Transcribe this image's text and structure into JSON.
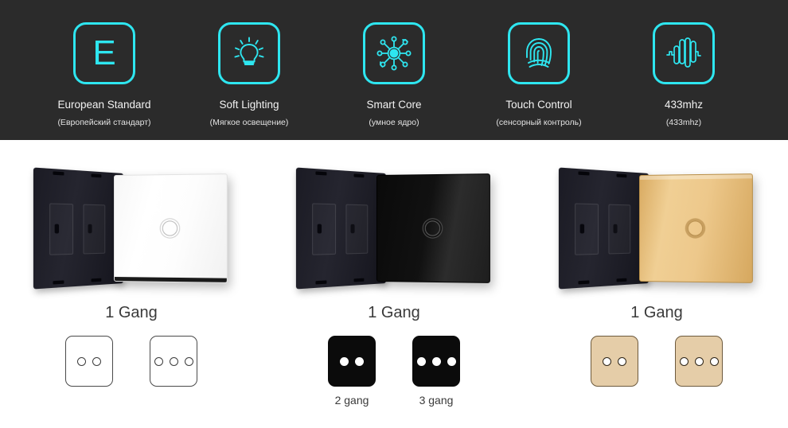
{
  "banner": {
    "background_color": "#2b2b2b",
    "accent_color": "#2ee6f0",
    "features": [
      {
        "icon": "letter-e-icon",
        "glyph": "E",
        "label": "European Standard",
        "sublabel": "(Европейский стандарт)"
      },
      {
        "icon": "lightbulb-icon",
        "glyph": "",
        "label": "Soft Lighting",
        "sublabel": "(Мягкое освещение)"
      },
      {
        "icon": "smart-core-hub-icon",
        "glyph": "",
        "label": "Smart Core",
        "sublabel": "(умное ядро)"
      },
      {
        "icon": "fingerprint-icon",
        "glyph": "",
        "label": "Touch Control",
        "sublabel": "(сенсорный контроль)"
      },
      {
        "icon": "radio-waveform-icon",
        "glyph": "",
        "label": "433mhz",
        "sublabel": "(433mhz)"
      }
    ]
  },
  "products": [
    {
      "color_name": "white",
      "panel_color": "#ffffff",
      "caption": "1 Gang",
      "variants": [
        {
          "gangs": 2,
          "label": ""
        },
        {
          "gangs": 3,
          "label": ""
        }
      ]
    },
    {
      "color_name": "black",
      "panel_color": "#0b0b0b",
      "caption": "1 Gang",
      "variants": [
        {
          "gangs": 2,
          "label": "2 gang"
        },
        {
          "gangs": 3,
          "label": "3 gang"
        }
      ]
    },
    {
      "color_name": "gold",
      "panel_color": "#e5cda8",
      "caption": "1 Gang",
      "variants": [
        {
          "gangs": 2,
          "label": ""
        },
        {
          "gangs": 3,
          "label": ""
        }
      ]
    }
  ]
}
